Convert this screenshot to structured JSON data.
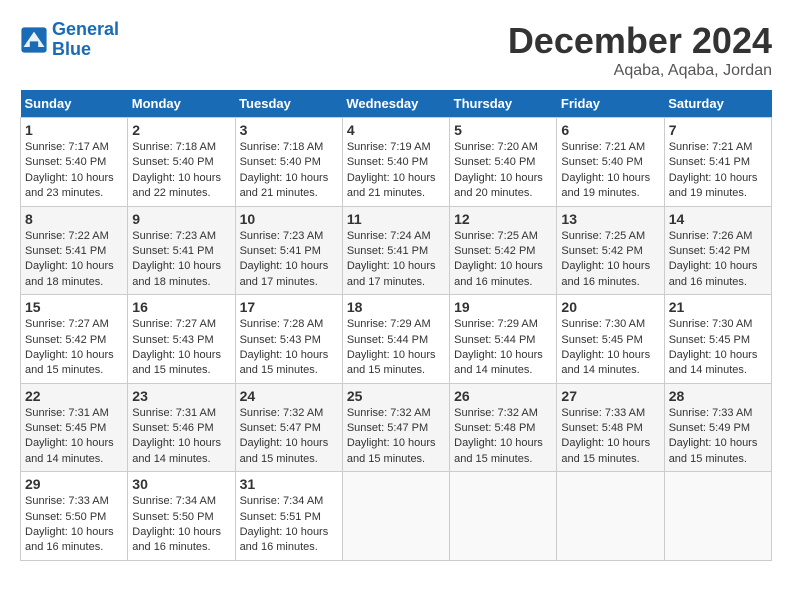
{
  "header": {
    "logo_line1": "General",
    "logo_line2": "Blue",
    "month": "December 2024",
    "location": "Aqaba, Aqaba, Jordan"
  },
  "days_of_week": [
    "Sunday",
    "Monday",
    "Tuesday",
    "Wednesday",
    "Thursday",
    "Friday",
    "Saturday"
  ],
  "weeks": [
    [
      {
        "day": "1",
        "sunrise": "7:17 AM",
        "sunset": "5:40 PM",
        "daylight": "10 hours and 23 minutes."
      },
      {
        "day": "2",
        "sunrise": "7:18 AM",
        "sunset": "5:40 PM",
        "daylight": "10 hours and 22 minutes."
      },
      {
        "day": "3",
        "sunrise": "7:18 AM",
        "sunset": "5:40 PM",
        "daylight": "10 hours and 21 minutes."
      },
      {
        "day": "4",
        "sunrise": "7:19 AM",
        "sunset": "5:40 PM",
        "daylight": "10 hours and 21 minutes."
      },
      {
        "day": "5",
        "sunrise": "7:20 AM",
        "sunset": "5:40 PM",
        "daylight": "10 hours and 20 minutes."
      },
      {
        "day": "6",
        "sunrise": "7:21 AM",
        "sunset": "5:40 PM",
        "daylight": "10 hours and 19 minutes."
      },
      {
        "day": "7",
        "sunrise": "7:21 AM",
        "sunset": "5:41 PM",
        "daylight": "10 hours and 19 minutes."
      }
    ],
    [
      {
        "day": "8",
        "sunrise": "7:22 AM",
        "sunset": "5:41 PM",
        "daylight": "10 hours and 18 minutes."
      },
      {
        "day": "9",
        "sunrise": "7:23 AM",
        "sunset": "5:41 PM",
        "daylight": "10 hours and 18 minutes."
      },
      {
        "day": "10",
        "sunrise": "7:23 AM",
        "sunset": "5:41 PM",
        "daylight": "10 hours and 17 minutes."
      },
      {
        "day": "11",
        "sunrise": "7:24 AM",
        "sunset": "5:41 PM",
        "daylight": "10 hours and 17 minutes."
      },
      {
        "day": "12",
        "sunrise": "7:25 AM",
        "sunset": "5:42 PM",
        "daylight": "10 hours and 16 minutes."
      },
      {
        "day": "13",
        "sunrise": "7:25 AM",
        "sunset": "5:42 PM",
        "daylight": "10 hours and 16 minutes."
      },
      {
        "day": "14",
        "sunrise": "7:26 AM",
        "sunset": "5:42 PM",
        "daylight": "10 hours and 16 minutes."
      }
    ],
    [
      {
        "day": "15",
        "sunrise": "7:27 AM",
        "sunset": "5:42 PM",
        "daylight": "10 hours and 15 minutes."
      },
      {
        "day": "16",
        "sunrise": "7:27 AM",
        "sunset": "5:43 PM",
        "daylight": "10 hours and 15 minutes."
      },
      {
        "day": "17",
        "sunrise": "7:28 AM",
        "sunset": "5:43 PM",
        "daylight": "10 hours and 15 minutes."
      },
      {
        "day": "18",
        "sunrise": "7:29 AM",
        "sunset": "5:44 PM",
        "daylight": "10 hours and 15 minutes."
      },
      {
        "day": "19",
        "sunrise": "7:29 AM",
        "sunset": "5:44 PM",
        "daylight": "10 hours and 14 minutes."
      },
      {
        "day": "20",
        "sunrise": "7:30 AM",
        "sunset": "5:45 PM",
        "daylight": "10 hours and 14 minutes."
      },
      {
        "day": "21",
        "sunrise": "7:30 AM",
        "sunset": "5:45 PM",
        "daylight": "10 hours and 14 minutes."
      }
    ],
    [
      {
        "day": "22",
        "sunrise": "7:31 AM",
        "sunset": "5:45 PM",
        "daylight": "10 hours and 14 minutes."
      },
      {
        "day": "23",
        "sunrise": "7:31 AM",
        "sunset": "5:46 PM",
        "daylight": "10 hours and 14 minutes."
      },
      {
        "day": "24",
        "sunrise": "7:32 AM",
        "sunset": "5:47 PM",
        "daylight": "10 hours and 15 minutes."
      },
      {
        "day": "25",
        "sunrise": "7:32 AM",
        "sunset": "5:47 PM",
        "daylight": "10 hours and 15 minutes."
      },
      {
        "day": "26",
        "sunrise": "7:32 AM",
        "sunset": "5:48 PM",
        "daylight": "10 hours and 15 minutes."
      },
      {
        "day": "27",
        "sunrise": "7:33 AM",
        "sunset": "5:48 PM",
        "daylight": "10 hours and 15 minutes."
      },
      {
        "day": "28",
        "sunrise": "7:33 AM",
        "sunset": "5:49 PM",
        "daylight": "10 hours and 15 minutes."
      }
    ],
    [
      {
        "day": "29",
        "sunrise": "7:33 AM",
        "sunset": "5:50 PM",
        "daylight": "10 hours and 16 minutes."
      },
      {
        "day": "30",
        "sunrise": "7:34 AM",
        "sunset": "5:50 PM",
        "daylight": "10 hours and 16 minutes."
      },
      {
        "day": "31",
        "sunrise": "7:34 AM",
        "sunset": "5:51 PM",
        "daylight": "10 hours and 16 minutes."
      },
      null,
      null,
      null,
      null
    ]
  ]
}
